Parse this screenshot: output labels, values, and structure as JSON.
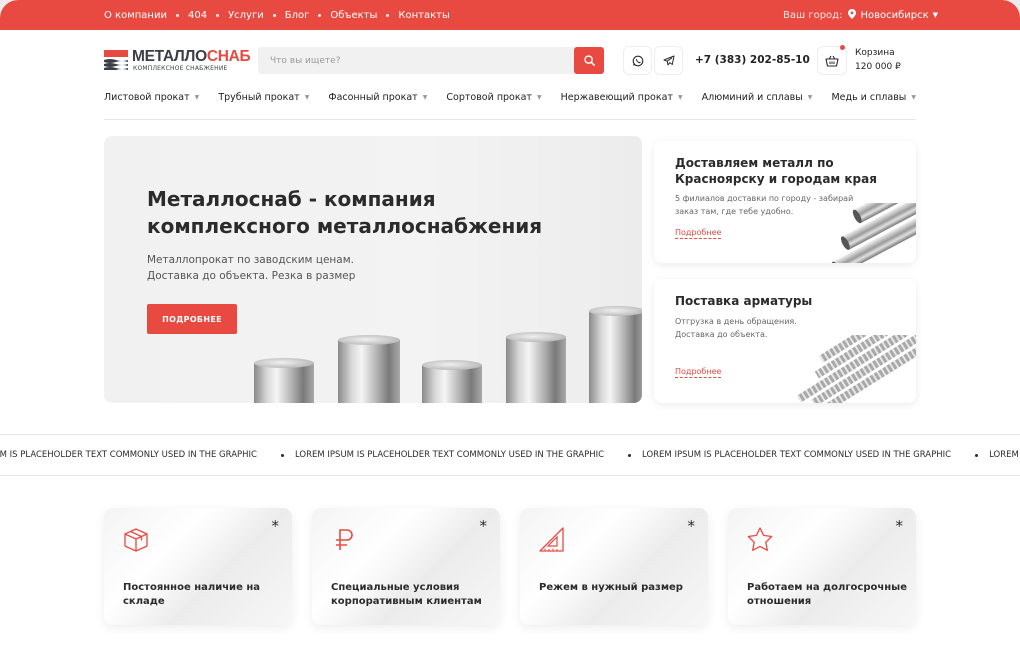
{
  "topbar": {
    "links": [
      "О компании",
      "404",
      "Услуги",
      "Блог",
      "Объекты",
      "Контакты"
    ],
    "city_label": "Ваш город:",
    "city": "Новосибирск"
  },
  "header": {
    "logo_main": "МЕТАЛЛО",
    "logo_accent": "СНАБ",
    "logo_tagline": "КОМПЛЕКСНОЕ СНАБЖЕНИЕ",
    "search_placeholder": "Что вы ищете?",
    "phone": "+7 (383) 202-85-10",
    "cart_label": "Корзина",
    "cart_total": "120 000 ₽"
  },
  "categories": [
    "Листовой прокат",
    "Трубный прокат",
    "Фасонный прокат",
    "Сортовой прокат",
    "Нержавеющий прокат",
    "Алюминий и сплавы",
    "Медь и сплавы"
  ],
  "hero": {
    "title": "Металлоснаб - компания комплексного металлоснабжения",
    "line1": "Металлопрокат по заводским ценам.",
    "line2": "Доставка до объекта. Резка в размер",
    "cta": "ПОДРОБНЕЕ"
  },
  "promo": [
    {
      "title_1": "Доставляем металл по",
      "title_2": "Красноярску и городам края",
      "desc_1": "5 филиалов доставки по городу - забирай",
      "desc_2": "заказ там, где тебе удобно.",
      "more": "Подробнее"
    },
    {
      "title_1": "Поставка арматуры",
      "title_2": "",
      "desc_1": "Отгрузка в день обращения.",
      "desc_2": "Доставка до объекта.",
      "more": "Подробнее"
    }
  ],
  "marquee_text": "LOREM IPSUM IS PLACEHOLDER TEXT COMMONLY USED IN THE GRAPHIC",
  "marquee_head": "SUM IS PLACEHOLDER TEXT COMMONLY USED IN THE GRAPHIC",
  "marquee_tail": "LOREM IPSU",
  "features": [
    {
      "icon": "box-icon",
      "title": "Постоянное наличие на складе",
      "mark": "*"
    },
    {
      "icon": "ruble-icon",
      "title": "Специальные условия корпоративным клиентам",
      "mark": "*"
    },
    {
      "icon": "triangle-ruler-icon",
      "title": "Режем в нужный размер",
      "mark": "*"
    },
    {
      "icon": "star-icon",
      "title": "Работаем на долгосрочные отношения",
      "mark": "*"
    }
  ],
  "colors": {
    "accent": "#e84a42",
    "text": "#2b2b2b"
  }
}
